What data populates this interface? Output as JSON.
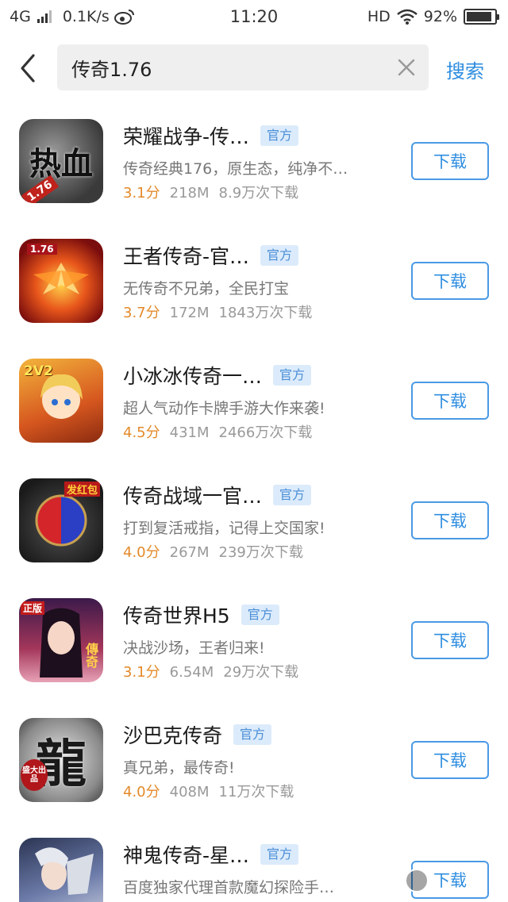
{
  "status_bar": {
    "network": "4G",
    "speed": "0.1K/s",
    "time": "11:20",
    "hd": "HD",
    "battery": "92%"
  },
  "search": {
    "query": "传奇1.76",
    "button_label": "搜索"
  },
  "apps": [
    {
      "name": "荣耀战争-传…",
      "badge": "官方",
      "desc": "传奇经典176，原生态，纯净不…",
      "score": "3.1分",
      "size": "218M",
      "downloads": "8.9万次下载",
      "button": "下载",
      "icon_text": "热血",
      "icon_tag": "1.76"
    },
    {
      "name": "王者传奇-官…",
      "badge": "官方",
      "desc": "无传奇不兄弟，全民打宝",
      "score": "3.7分",
      "size": "172M",
      "downloads": "1843万次下载",
      "button": "下载",
      "icon_text": "",
      "icon_tag": "1.76"
    },
    {
      "name": "小冰冰传奇一…",
      "badge": "官方",
      "desc": "超人气动作卡牌手游大作来袭!",
      "score": "4.5分",
      "size": "431M",
      "downloads": "2466万次下载",
      "button": "下载",
      "icon_text": "",
      "icon_tag": "2V2"
    },
    {
      "name": "传奇战域一官…",
      "badge": "官方",
      "desc": "打到复活戒指，记得上交国家!",
      "score": "4.0分",
      "size": "267M",
      "downloads": "239万次下载",
      "button": "下载",
      "icon_text": "",
      "icon_tag": "发红包"
    },
    {
      "name": "传奇世界H5",
      "badge": "官方",
      "desc": "决战沙场，王者归来!",
      "score": "3.1分",
      "size": "6.54M",
      "downloads": "29万次下载",
      "button": "下载",
      "icon_text": "傳奇",
      "icon_tag": "正版"
    },
    {
      "name": "沙巴克传奇",
      "badge": "官方",
      "desc": "真兄弟，最传奇!",
      "score": "4.0分",
      "size": "408M",
      "downloads": "11万次下载",
      "button": "下载",
      "icon_text": "龍",
      "icon_tag": "盛大出品"
    },
    {
      "name": "神鬼传奇-星…",
      "badge": "官方",
      "desc": "百度独家代理首款魔幻探险手…",
      "score": "",
      "size": "",
      "downloads": "",
      "button": "下载",
      "icon_text": "",
      "icon_tag": ""
    }
  ],
  "colors": {
    "accent": "#2e8de0",
    "score": "#e38a2a",
    "badge_bg": "#dcebfb"
  }
}
